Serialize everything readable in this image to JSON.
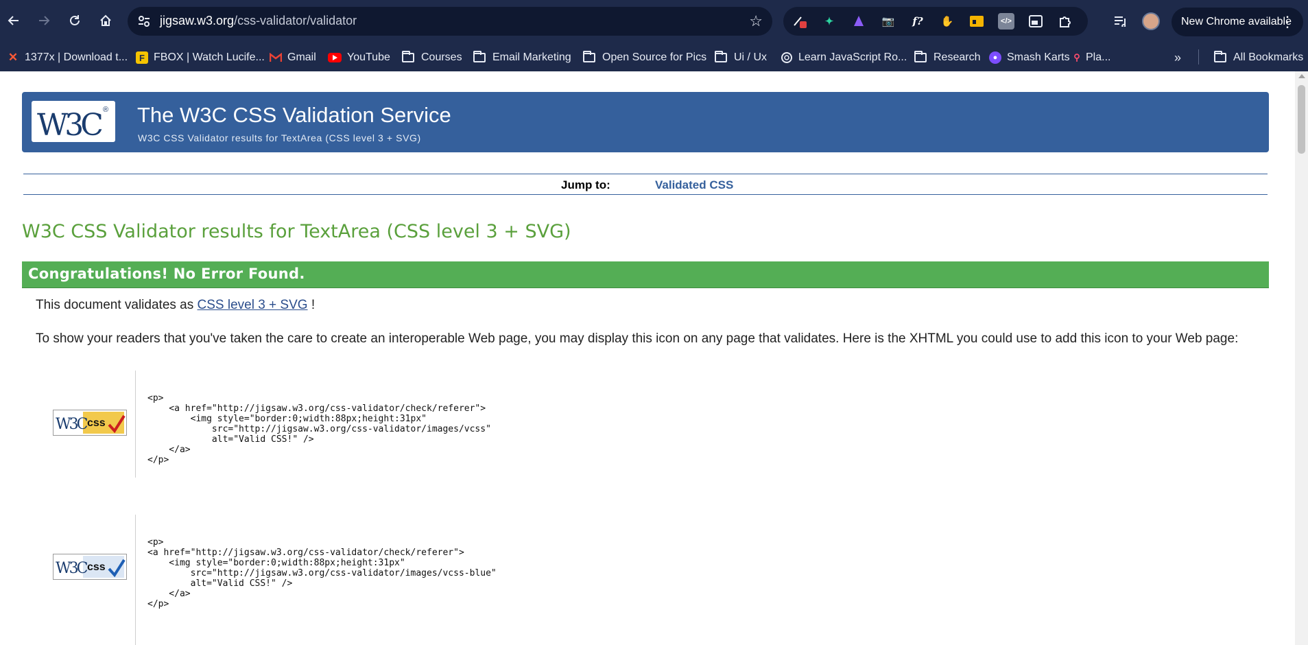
{
  "browser": {
    "url_host": "jigsaw.w3.org",
    "url_path": "/css-validator/validator",
    "update_label": "New Chrome available",
    "bookmarks": [
      {
        "label": "1377x | Download t...",
        "icon": "x-logo-icon"
      },
      {
        "label": "FBOX | Watch Lucife...",
        "icon": "fbox-icon"
      },
      {
        "label": "Gmail",
        "icon": "gmail-icon"
      },
      {
        "label": "YouTube",
        "icon": "youtube-icon"
      },
      {
        "label": "Courses",
        "icon": "folder-icon"
      },
      {
        "label": "Email Marketing",
        "icon": "folder-icon"
      },
      {
        "label": "Open Source for Pics",
        "icon": "folder-icon"
      },
      {
        "label": "Ui / Ux",
        "icon": "folder-icon"
      },
      {
        "label": "Learn JavaScript Ro...",
        "icon": "openai-icon"
      },
      {
        "label": "Research",
        "icon": "folder-icon"
      },
      {
        "label": "Smash Karts",
        "icon": "smash-karts-icon"
      },
      {
        "label": "Pla...",
        "icon": "joystick-icon"
      }
    ],
    "all_bookmarks_label": "All Bookmarks",
    "colors": {
      "chrome_bg": "#1e2a4a",
      "omnibox_bg": "#0f1830"
    }
  },
  "page": {
    "banner": {
      "title": "The W3C CSS Validation Service",
      "subtitle": "W3C CSS Validator results for TextArea (CSS level 3 + SVG)",
      "color": "#35609c"
    },
    "jump": {
      "label": "Jump to:",
      "link": "Validated CSS"
    },
    "results_heading": "W3C CSS Validator results for TextArea (CSS level 3 + SVG)",
    "congrats": "Congratulations! No Error Found.",
    "validates_prefix": "This document validates as",
    "validates_link": "CSS level 3 + SVG",
    "validates_suffix": " !",
    "icon_paragraph": "To show your readers that you've taken the care to create an interoperable Web page, you may display this icon on any page that validates. Here is the XHTML you could use to add this icon to your Web page:",
    "badges": [
      {
        "name": "vcss",
        "logo_text": "W3C",
        "css_text": "css",
        "code": "<p>\n    <a href=\"http://jigsaw.w3.org/css-validator/check/referer\">\n        <img style=\"border:0;width:88px;height:31px\"\n            src=\"http://jigsaw.w3.org/css-validator/images/vcss\"\n            alt=\"Valid CSS!\" />\n    </a>\n</p>"
      },
      {
        "name": "vcss-blue",
        "logo_text": "W3C",
        "css_text": "css",
        "code": "<p>\n<a href=\"http://jigsaw.w3.org/css-validator/check/referer\">\n    <img style=\"border:0;width:88px;height:31px\"\n        src=\"http://jigsaw.w3.org/css-validator/images/vcss-blue\"\n        alt=\"Valid CSS!\" />\n    </a>\n</p>"
      }
    ],
    "colors": {
      "success": "#54ae55",
      "heading": "#5aa03c",
      "link": "#2b4d8c"
    }
  }
}
